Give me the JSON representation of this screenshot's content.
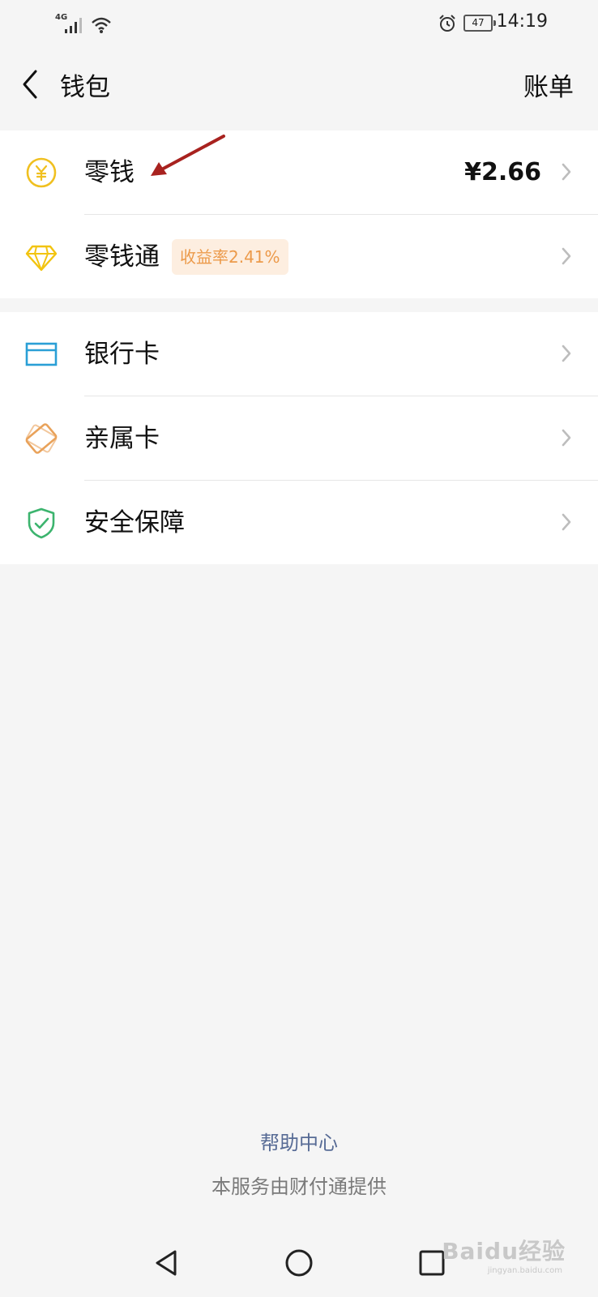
{
  "status_bar": {
    "network": "4G",
    "battery": "47",
    "time": "14:19"
  },
  "header": {
    "title": "钱包",
    "bill_label": "账单"
  },
  "group1": [
    {
      "label": "零钱",
      "amount": "¥2.66",
      "icon": "yuan-coin-icon"
    },
    {
      "label": "零钱通",
      "badge": "收益率2.41%",
      "icon": "diamond-icon"
    }
  ],
  "group2": [
    {
      "label": "银行卡",
      "icon": "bank-card-icon"
    },
    {
      "label": "亲属卡",
      "icon": "family-card-icon"
    },
    {
      "label": "安全保障",
      "icon": "security-shield-icon"
    }
  ],
  "footer": {
    "help": "帮助中心",
    "provider": "本服务由财付通提供"
  },
  "watermark": {
    "brand": "Baidu经验",
    "url": "jingyan.baidu.com"
  },
  "colors": {
    "yuan": "#f0c020",
    "diamond": "#f2c410",
    "bank_card": "#2a9fd6",
    "family_card": "#e9a25a",
    "security": "#3cb46e",
    "badge_text": "#ec9a4a",
    "badge_bg": "#fdeee0",
    "link": "#576b95"
  }
}
